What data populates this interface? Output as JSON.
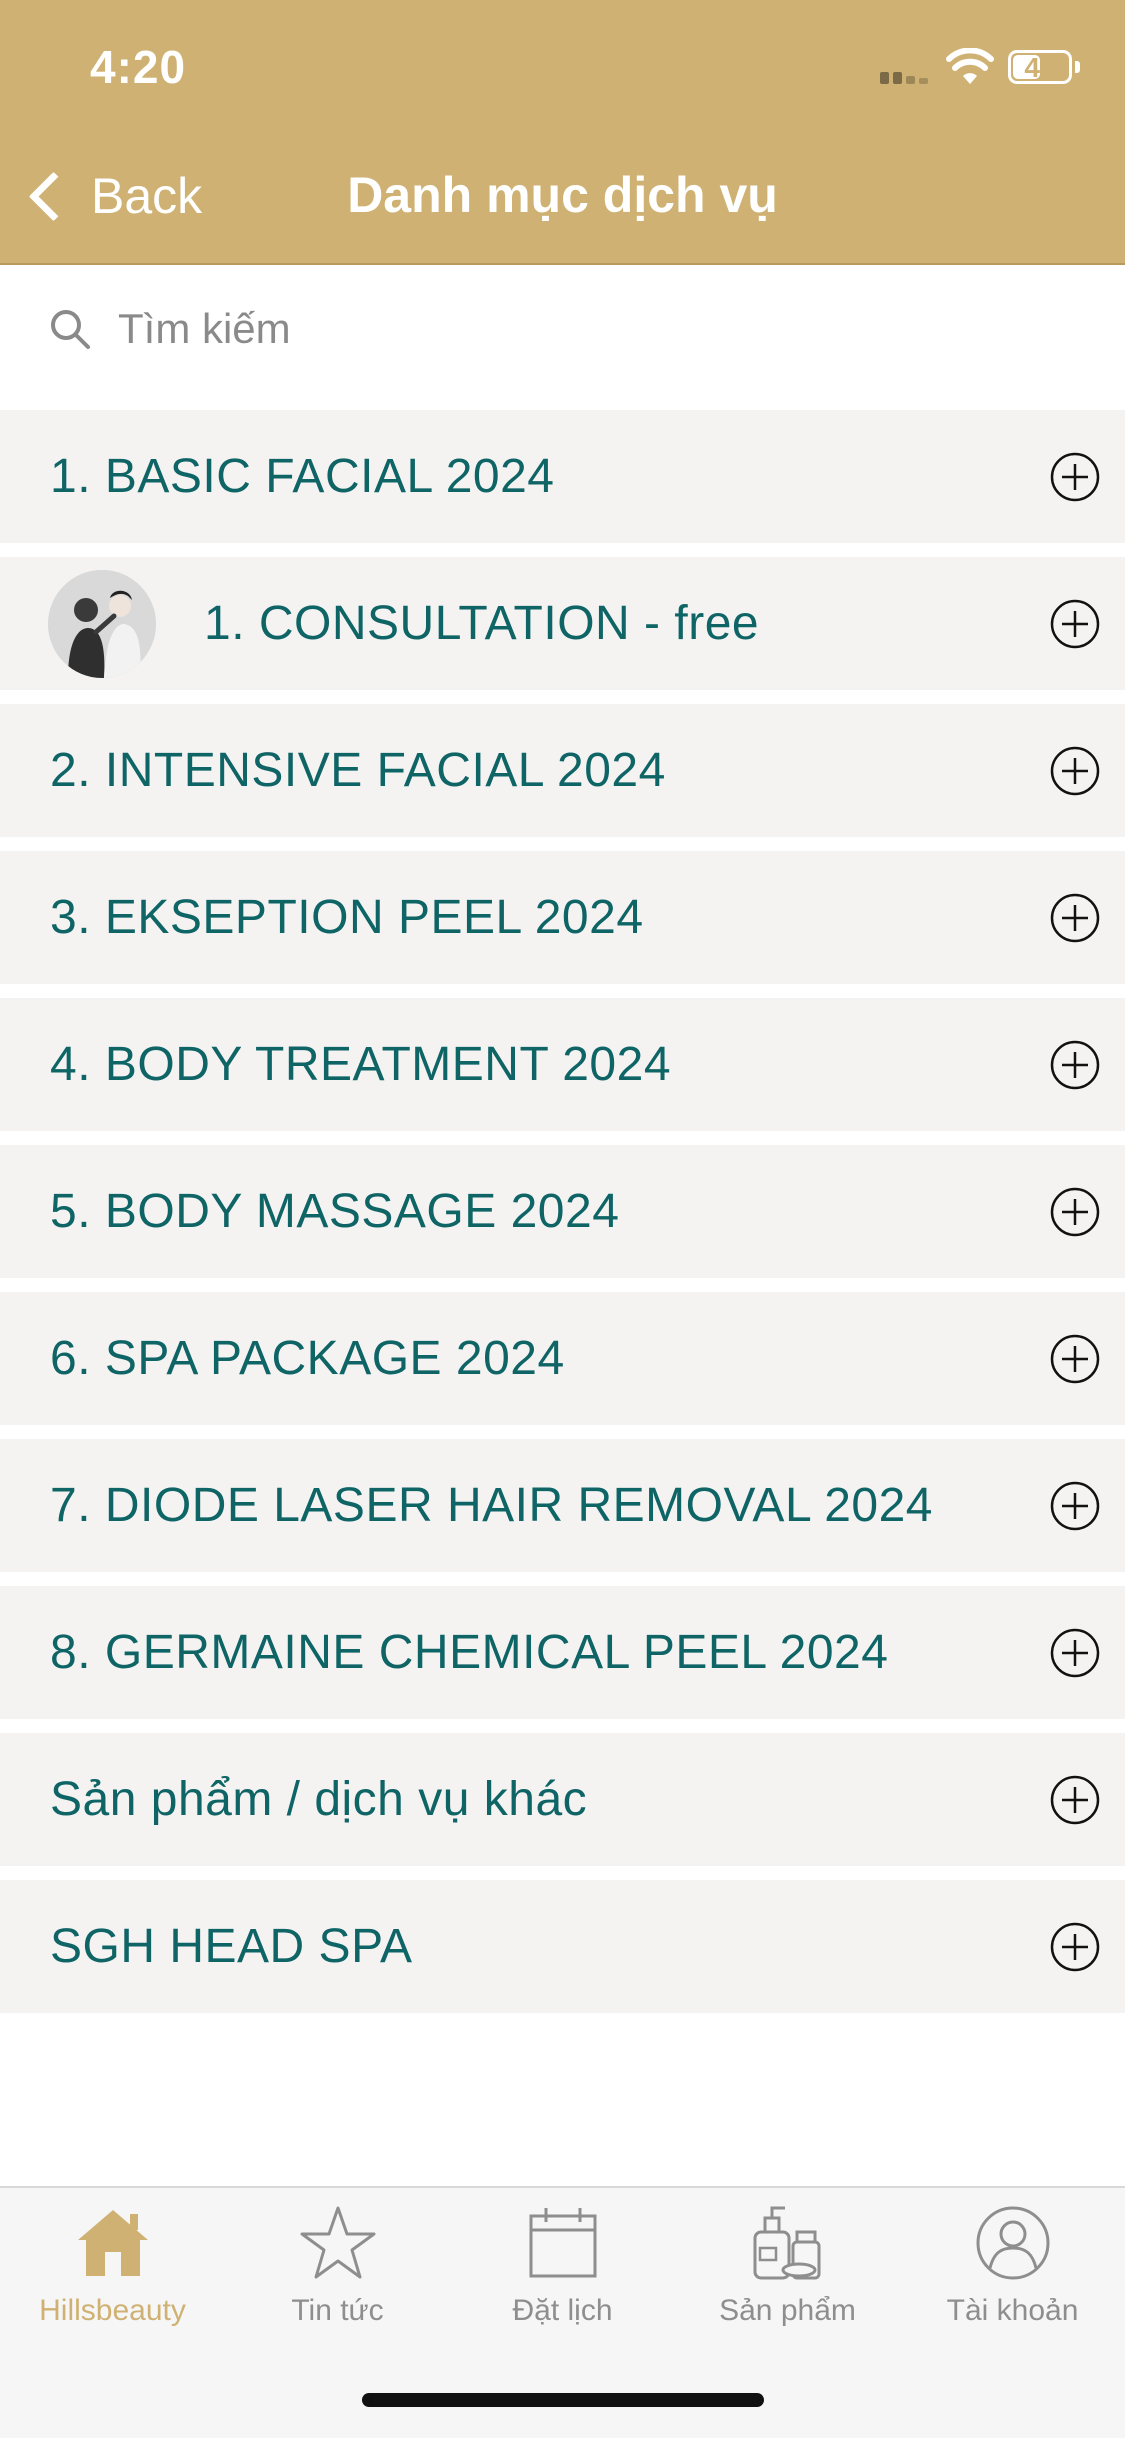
{
  "status_bar": {
    "time": "4:20",
    "battery": "47"
  },
  "nav": {
    "back_label": "Back",
    "title": "Danh mục dịch vụ"
  },
  "search": {
    "placeholder": "Tìm kiếm"
  },
  "categories": [
    {
      "label": "1. BASIC FACIAL 2024"
    },
    {
      "label": "1. CONSULTATION - free",
      "has_thumbnail": true
    },
    {
      "label": "2. INTENSIVE FACIAL 2024"
    },
    {
      "label": "3. EKSEPTION PEEL 2024"
    },
    {
      "label": "4. BODY TREATMENT 2024"
    },
    {
      "label": "5. BODY MASSAGE 2024"
    },
    {
      "label": "6. SPA PACKAGE 2024"
    },
    {
      "label": "7. DIODE LASER HAIR REMOVAL 2024"
    },
    {
      "label": "8. GERMAINE CHEMICAL PEEL 2024"
    },
    {
      "label": "Sản phẩm / dịch vụ khác"
    },
    {
      "label": "SGH HEAD SPA"
    }
  ],
  "tabbar": {
    "tabs": [
      {
        "label": "Hillsbeauty",
        "icon": "home-icon",
        "active": true
      },
      {
        "label": "Tin tức",
        "icon": "star-icon"
      },
      {
        "label": "Đặt lịch",
        "icon": "calendar-icon"
      },
      {
        "label": "Sản phẩm",
        "icon": "products-icon"
      },
      {
        "label": "Tài khoản",
        "icon": "account-icon"
      }
    ]
  },
  "colors": {
    "header": "#cfb273",
    "accent_text": "#0f6466",
    "row_background": "#f4f3f2",
    "tab_active": "#cfb273",
    "tab_inactive": "#8e8e8e"
  }
}
